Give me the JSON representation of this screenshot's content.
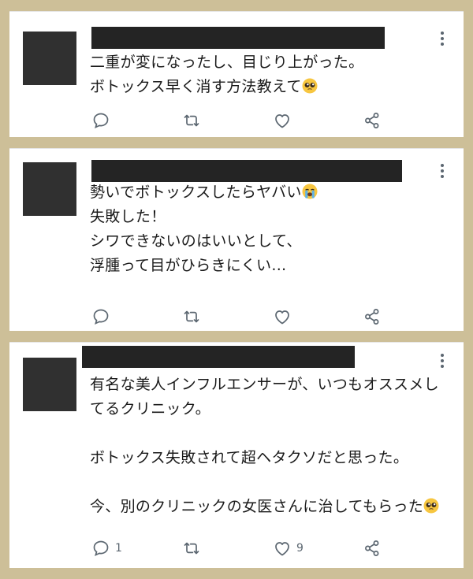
{
  "posts": [
    {
      "lines": [
        "二重が変になったし、目じり上がった。",
        "ボトックス早く消す方法教えて"
      ],
      "emoji": "pleading-face-emoji",
      "reply_count": "",
      "like_count": ""
    },
    {
      "lines": [
        "勢いでボトックスしたらヤバい",
        "失敗した！",
        "シワできないのはいいとして、",
        "浮腫って目がひらきにくい…"
      ],
      "emoji": "loudly-crying-face-emoji",
      "reply_count": "",
      "like_count": ""
    },
    {
      "lines": [
        "有名な美人インフルエンサーが、いつもオススメしてるクリニック。",
        "",
        "ボトックス失敗されて超ヘタクソだと思った。",
        "",
        "今、別のクリニックの女医さんに治してもらった"
      ],
      "emoji": "pleading-face-emoji",
      "reply_count": "1",
      "like_count": "9"
    }
  ],
  "colors": {
    "background": "#cdbf98",
    "card": "#ffffff",
    "icon": "#5b6670",
    "redaction": "#242424"
  }
}
